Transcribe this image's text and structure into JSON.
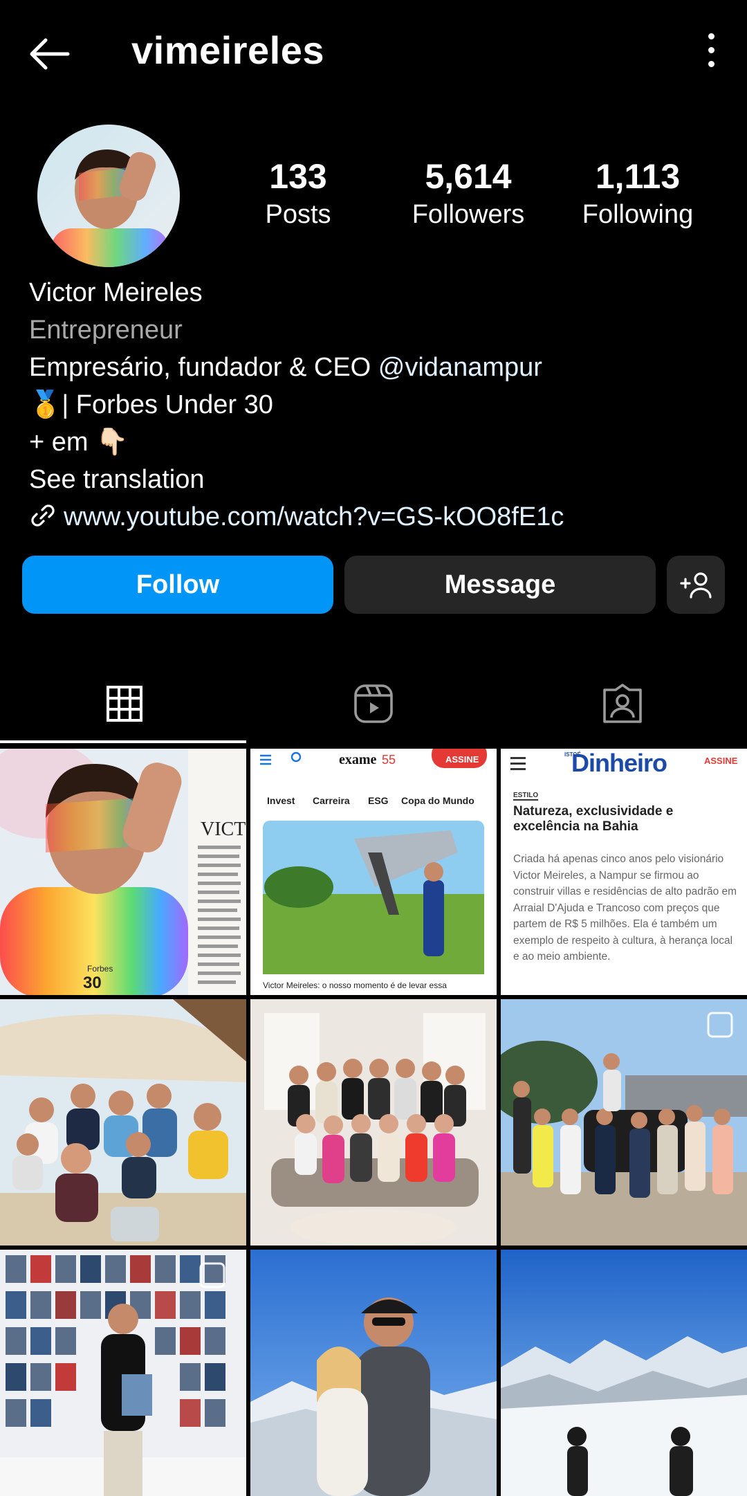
{
  "header": {
    "username": "vimeireles",
    "back_icon": "arrow-left-icon",
    "menu_icon": "more-vertical-icon"
  },
  "stats": {
    "posts": {
      "value": "133",
      "label": "Posts"
    },
    "followers": {
      "value": "5,614",
      "label": "Followers"
    },
    "following": {
      "value": "1,113",
      "label": "Following"
    }
  },
  "bio": {
    "name": "Victor Meireles",
    "category": "Entrepreneur",
    "line1_prefix": "Empresário, fundador & CEO ",
    "line1_mention": "@vidanampur",
    "line2_emoji": "🥇",
    "line2_text": "| Forbes Under 30",
    "line3_text": "+ em ",
    "line3_emoji": "👇🏻",
    "see_translation": "See translation",
    "link": "www.youtube.com/watch?v=GS-kOO8fE1c"
  },
  "actions": {
    "follow_label": "Follow",
    "message_label": "Message",
    "add_person_icon": "add-person-icon"
  },
  "tabs": {
    "active": "grid"
  },
  "grid": {
    "exame_logo": "exame",
    "exame_badge": "55",
    "assine_label": "ASSINE",
    "exame_nav": [
      "Invest",
      "Carreira",
      "ESG",
      "Copa do Mundo"
    ],
    "exame_caption": "Victor Meireles: o nosso momento é de levar essa",
    "forbes_word": "Forbes",
    "forbes_30": "30",
    "victor_heading": "VICTOR",
    "dinheiro_prefix": "ISTOÉ",
    "dinheiro_logo": "Dinheiro",
    "dinheiro_section": "ESTILO",
    "dinheiro_headline": "Natureza, exclusividade e excelência na Bahia",
    "dinheiro_body": "Criada há apenas cinco anos pelo visionário Victor Meireles, a Nampur se firmou ao construir villas e residências de alto padrão em Arraial D'Ajuda e Trancoso com preços que partem de R$ 5 milhões. Ela é também um exemplo de respeito à cultura, à herança local e ao meio ambiente.",
    "colors": {
      "accent": "#0095f6",
      "button_dark": "#262626",
      "muted": "#a8a8a8",
      "link": "#e0f1ff"
    }
  }
}
